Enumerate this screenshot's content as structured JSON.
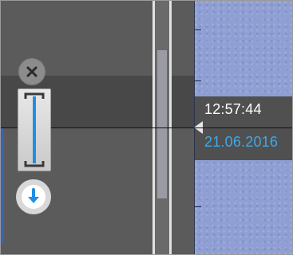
{
  "timeline": {
    "current_time": "12:57:44",
    "current_date": "21.06.2016"
  },
  "controls": {
    "close_icon": "close-icon",
    "range_icon": "range-select-icon",
    "jump_icon": "arrow-down-icon"
  },
  "colors": {
    "timeline_bg": "#8f9fd4",
    "date_text": "#3fa8e8",
    "time_text": "#ffffff",
    "accent_blue": "#1e8fe6",
    "panel_bg": "#5b5b5b"
  }
}
